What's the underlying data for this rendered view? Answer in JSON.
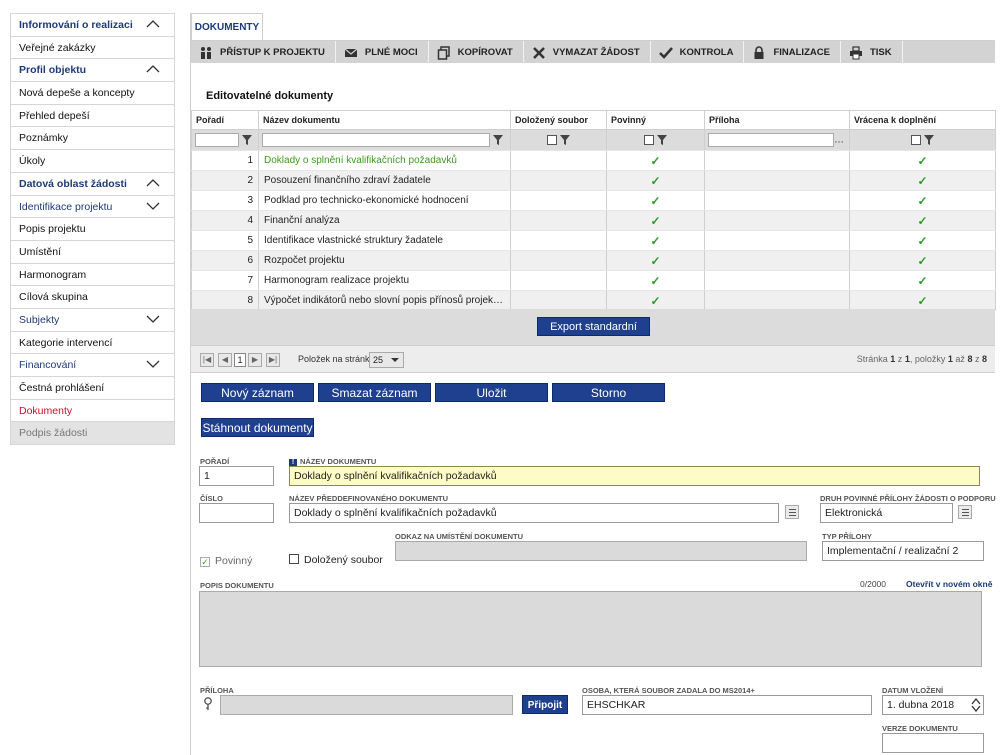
{
  "sidebar": {
    "items": [
      {
        "label": "Informování o realizaci",
        "kind": "head",
        "chevron": "up"
      },
      {
        "label": "Veřejné zakázky",
        "kind": "item"
      },
      {
        "label": "Profil objektu",
        "kind": "head",
        "chevron": "up"
      },
      {
        "label": "Nová depeše a koncepty",
        "kind": "item"
      },
      {
        "label": "Přehled depeší",
        "kind": "item"
      },
      {
        "label": "Poznámky",
        "kind": "item"
      },
      {
        "label": "Úkoly",
        "kind": "item"
      },
      {
        "label": "Datová oblast žádosti",
        "kind": "head",
        "chevron": "up"
      },
      {
        "label": "Identifikace projektu",
        "kind": "sub",
        "chevron": "down"
      },
      {
        "label": "Popis projektu",
        "kind": "item"
      },
      {
        "label": "Umístění",
        "kind": "item"
      },
      {
        "label": "Harmonogram",
        "kind": "item"
      },
      {
        "label": "Cílová skupina",
        "kind": "item"
      },
      {
        "label": "Subjekty",
        "kind": "sub",
        "chevron": "down"
      },
      {
        "label": "Kategorie intervencí",
        "kind": "item"
      },
      {
        "label": "Financování",
        "kind": "sub",
        "chevron": "down"
      },
      {
        "label": "Čestná prohlášení",
        "kind": "item"
      },
      {
        "label": "Dokumenty",
        "kind": "active"
      },
      {
        "label": "Podpis žádosti",
        "kind": "disabled"
      }
    ]
  },
  "tab": {
    "label": "DOKUMENTY"
  },
  "toolbar": [
    {
      "label": "PŘÍSTUP K PROJEKTU",
      "icon": "people-icon"
    },
    {
      "label": "PLNÉ MOCI",
      "icon": "envelope-icon"
    },
    {
      "label": "KOPÍROVAT",
      "icon": "copy-icon"
    },
    {
      "label": "VYMAZAT ŽÁDOST",
      "icon": "x-icon"
    },
    {
      "label": "KONTROLA",
      "icon": "check-icon"
    },
    {
      "label": "FINALIZACE",
      "icon": "lock-icon"
    },
    {
      "label": "TISK",
      "icon": "printer-icon"
    }
  ],
  "grid": {
    "title": "Editovatelné dokumenty",
    "columns": [
      "Pořadí",
      "Název dokumentu",
      "Doložený soubor",
      "Povinný",
      "Příloha",
      "Vrácena k doplnění"
    ],
    "rows": [
      {
        "poradi": "1",
        "nazev": "Doklady o splnění kvalifikačních požadavků",
        "povinny": true,
        "vracena": true
      },
      {
        "poradi": "2",
        "nazev": "Posouzení finančního zdraví žadatele",
        "povinny": true,
        "vracena": true
      },
      {
        "poradi": "3",
        "nazev": "Podklad pro technicko-ekonomické hodnocení",
        "povinny": true,
        "vracena": true
      },
      {
        "poradi": "4",
        "nazev": "Finanční analýza",
        "povinny": true,
        "vracena": true
      },
      {
        "poradi": "5",
        "nazev": "Identifikace vlastnické struktury žadatele",
        "povinny": true,
        "vracena": true
      },
      {
        "poradi": "6",
        "nazev": "Rozpočet projektu",
        "povinny": true,
        "vracena": true
      },
      {
        "poradi": "7",
        "nazev": "Harmonogram realizace projektu",
        "povinny": true,
        "vracena": true
      },
      {
        "poradi": "8",
        "nazev": "Výpočet indikátorů nebo slovní popis přínosů projektu k...",
        "povinny": true,
        "vracena": true
      }
    ],
    "export_label": "Export standardní"
  },
  "pager": {
    "current": "1",
    "per_page_label": "Položek na stránku",
    "per_page": "25",
    "info_prefix": "Stránka",
    "info_page": "1",
    "info_of": "z",
    "info_pages": "1",
    "info_items": ", položky",
    "info_from": "1",
    "info_to_word": "až",
    "info_to": "8",
    "info_z": "z",
    "info_total": "8"
  },
  "form": {
    "buttons": {
      "new": "Nový záznam",
      "delete": "Smazat záznam",
      "save": "Uložit",
      "cancel": "Storno",
      "download": "Stáhnout dokumenty"
    },
    "poradi_label": "POŘADÍ",
    "poradi_value": "1",
    "nazev_label": "NÁZEV DOKUMENTU",
    "nazev_value": "Doklady o splnění kvalifikačních požadavků",
    "cislo_label": "ČÍSLO",
    "cislo_value": "",
    "predef_label": "NÁZEV PŘEDDEFINOVANÉHO DOKUMENTU",
    "predef_value": "Doklady o splnění kvalifikačních požadavků",
    "druh_label": "DRUH POVINNÉ PŘÍLOHY ŽÁDOSTI O PODPORU",
    "druh_value": "Elektronická",
    "povinny_label": "Povinný",
    "dolozeny_label": "Doložený soubor",
    "odkaz_label": "ODKAZ NA UMÍSTĚNÍ DOKUMENTU",
    "typ_label": "TYP PŘÍLOHY",
    "typ_value": "Implementační / realizační 2",
    "popis_label": "POPIS DOKUMENTU",
    "popis_count": "0/2000",
    "popis_link": "Otevřít v novém okně",
    "priloha_label": "PŘÍLOHA",
    "pripojit_label": "Připojit",
    "osoba_label": "OSOBA, KTERÁ SOUBOR ZADALA DO MS2014+",
    "osoba_value": "EHSCHKAR",
    "datum_label": "DATUM VLOŽENÍ",
    "datum_value": "1. dubna 2018",
    "verze_label": "VERZE DOKUMENTU",
    "verze_value": ""
  }
}
